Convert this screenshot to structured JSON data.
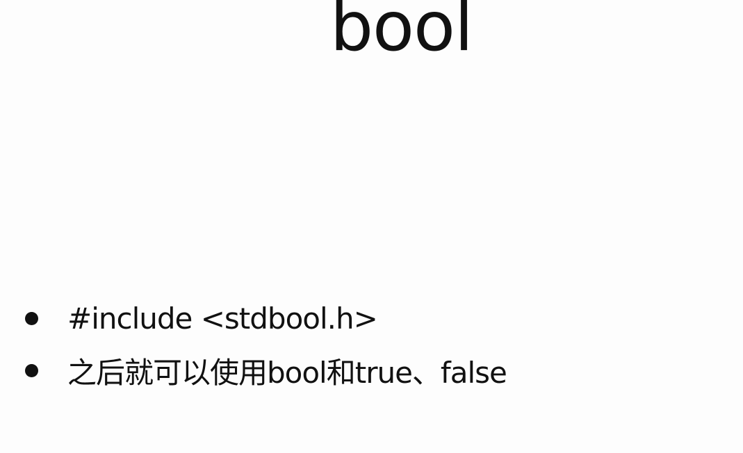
{
  "slide": {
    "title": "bool",
    "bullets": [
      {
        "text": "#include <stdbool.h>"
      },
      {
        "text": "之后就可以使用bool和true、false"
      }
    ]
  }
}
